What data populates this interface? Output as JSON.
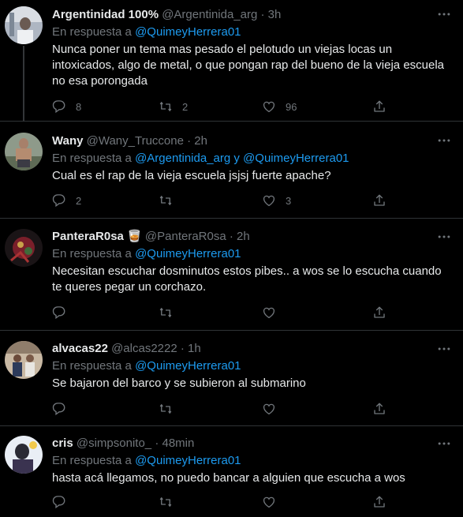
{
  "replying_prefix": "En respuesta a",
  "tweets": [
    {
      "name": "Argentinidad 100%",
      "handle": "@Argentinida_arg",
      "time": "· 3h",
      "reply_to": "@QuimeyHerrera01",
      "text": "Nunca poner un tema mas pesado el pelotudo un viejas locas un intoxicados, algo de metal, o que pongan rap del bueno de la vieja escuela no esa porongada",
      "replies": "8",
      "retweets": "2",
      "likes": "96"
    },
    {
      "name": "Wany",
      "handle": "@Wany_Truccone",
      "time": "· 2h",
      "reply_to_a": "@Argentinida_arg",
      "reply_join": "y",
      "reply_to_b": "@QuimeyHerrera01",
      "text": "Cual es el rap de la vieja escuela jsjsj fuerte apache?",
      "replies": "2",
      "retweets": "",
      "likes": "3"
    },
    {
      "name": "PanteraR0sa",
      "emoji": "🥃",
      "handle": "@PanteraR0sa",
      "time": "· 2h",
      "reply_to": "@QuimeyHerrera01",
      "text": "Necesitan escuchar dosminutos estos pibes.. a wos se lo escucha cuando te queres pegar un corchazo."
    },
    {
      "name": "alvacas22",
      "handle": "@alcas2222",
      "time": "· 1h",
      "reply_to": "@QuimeyHerrera01",
      "text": "Se bajaron del barco y se subieron al submarino"
    },
    {
      "name": "cris",
      "handle": "@simpsonito_",
      "time": "· 48min",
      "reply_to": "@QuimeyHerrera01",
      "text": "hasta acá llegamos, no puedo bancar a alguien que escucha a wos"
    }
  ],
  "colors": {
    "background": "#000000",
    "text": "#e7e9ea",
    "secondary": "#71767b",
    "link": "#1d9bf0",
    "divider": "#2f3336"
  },
  "icons": [
    "more-icon",
    "reply-icon",
    "retweet-icon",
    "like-icon",
    "share-icon"
  ]
}
